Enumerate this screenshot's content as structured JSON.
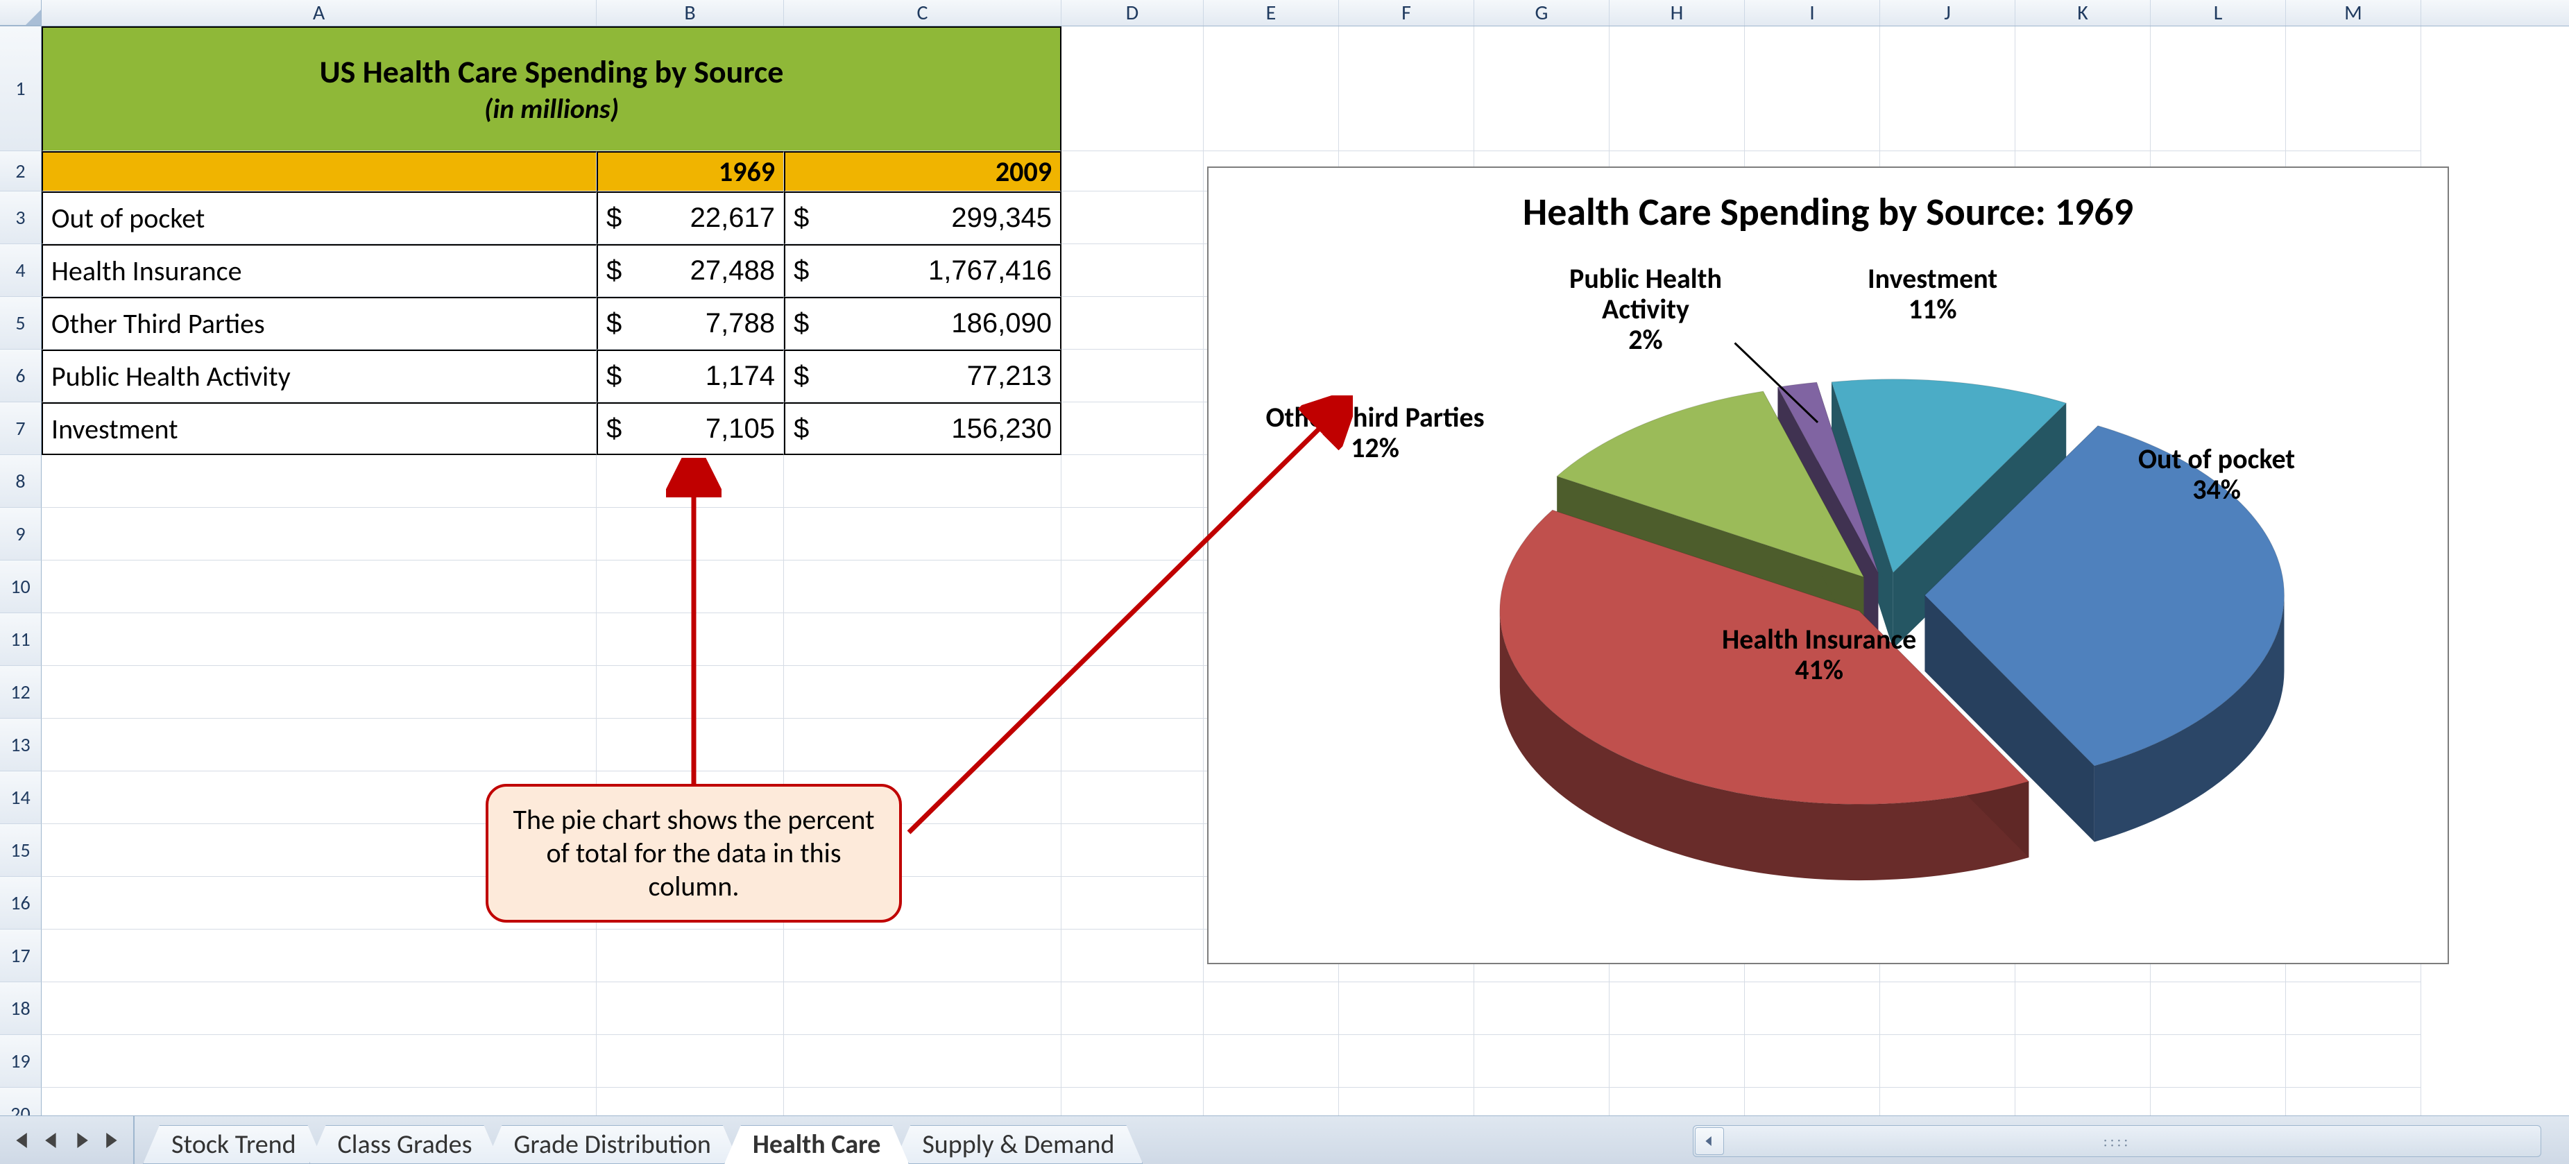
{
  "columns": [
    "A",
    "B",
    "C",
    "D",
    "E",
    "F",
    "G",
    "H",
    "I",
    "J",
    "K",
    "L",
    "M"
  ],
  "row_count": 20,
  "table": {
    "title": "US Health Care Spending by Source",
    "subtitle": "(in millions)",
    "year_headers": {
      "b": "1969",
      "c": "2009"
    },
    "rows": [
      {
        "label": "Out of pocket",
        "b": "22,617",
        "c": "299,345"
      },
      {
        "label": "Health Insurance",
        "b": "27,488",
        "c": "1,767,416"
      },
      {
        "label": "Other Third Parties",
        "b": "7,788",
        "c": "186,090"
      },
      {
        "label": "Public Health Activity",
        "b": "1,174",
        "c": "77,213"
      },
      {
        "label": "Investment",
        "b": "7,105",
        "c": "156,230"
      }
    ],
    "currency": "$"
  },
  "chart_data": {
    "type": "pie",
    "title": "Health Care Spending by Source: 1969",
    "series": [
      {
        "name": "Out of pocket",
        "value": 22617,
        "pct": 34,
        "color": "#4f81bd"
      },
      {
        "name": "Health Insurance",
        "value": 27488,
        "pct": 41,
        "color": "#c0504d"
      },
      {
        "name": "Other Third Parties",
        "value": 7788,
        "pct": 12,
        "color": "#9bbb59"
      },
      {
        "name": "Public Health Activity",
        "value": 1174,
        "pct": 2,
        "color": "#8064a2"
      },
      {
        "name": "Investment",
        "value": 7105,
        "pct": 11,
        "color": "#4bacc6"
      }
    ],
    "exploded": true,
    "three_d": true
  },
  "callout": {
    "text": "The pie chart shows the percent of total for the data in this column."
  },
  "tabs": {
    "items": [
      "Stock Trend",
      "Class Grades",
      "Grade Distribution",
      "Health Care",
      "Supply & Demand"
    ],
    "active_index": 3
  }
}
